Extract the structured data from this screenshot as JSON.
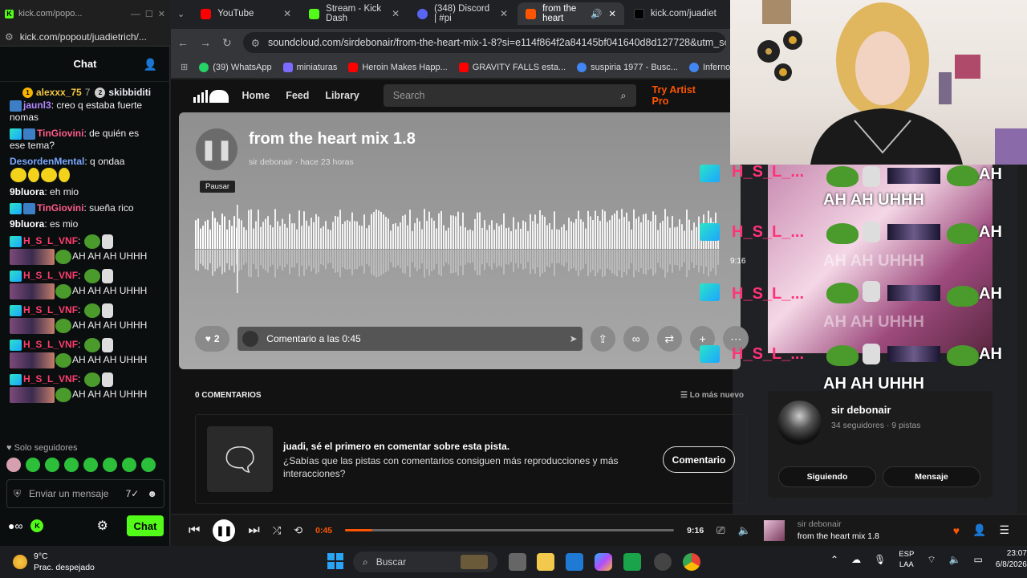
{
  "kick": {
    "window_title": "kick.com/popo...",
    "url": "kick.com/popout/juadietrich/...",
    "chat_title": "Chat",
    "gifters": [
      {
        "name": "alexxx_75",
        "count": "7"
      },
      {
        "name": "skibbiditi",
        "count": "2"
      }
    ],
    "messages": [
      {
        "user": "jaunl3",
        "color": "#b388ff",
        "text": "creo q estaba fuerte nomas"
      },
      {
        "user": "TinGiovini",
        "color": "#ff5c8a",
        "text": "de quién es ese tema?"
      },
      {
        "user": "DesordenMental",
        "color": "#7aa7ff",
        "text": "q ondaa"
      },
      {
        "user": "9bluora",
        "color": "#ffffff",
        "text": "eh mio"
      },
      {
        "user": "TinGiovini",
        "color": "#ff5c8a",
        "text": "sueña rico"
      },
      {
        "user": "9bluora",
        "color": "#ffffff",
        "text": "es mio"
      },
      {
        "user": "H_S_L_VNF",
        "color": "#ff3d6e",
        "text": "AH AH AH UHHH"
      },
      {
        "user": "H_S_L_VNF",
        "color": "#ff3d6e",
        "text": "AH AH AH UHHH"
      },
      {
        "user": "H_S_L_VNF",
        "color": "#ff3d6e",
        "text": "AH AH AH UHHH"
      },
      {
        "user": "H_S_L_VNF",
        "color": "#ff3d6e",
        "text": "AH AH AH UHHH"
      },
      {
        "user": "H_S_L_VNF",
        "color": "#ff3d6e",
        "text": "AH AH AH UHHH"
      }
    ],
    "followers_only": "Solo seguidores",
    "input_placeholder": "Enviar un mensaje",
    "chat_button": "Chat"
  },
  "browser": {
    "tabs": [
      {
        "title": "YouTube",
        "icon_color": "#ff0000",
        "active": false
      },
      {
        "title": "Stream - Kick Dash",
        "icon_color": "#53fc18",
        "active": false
      },
      {
        "title": "(348) Discord | #pi",
        "icon_color": "#5865f2",
        "active": false
      },
      {
        "title": "from the heart",
        "icon_color": "#ff5500",
        "active": true
      },
      {
        "title": "kick.com/juadiet",
        "icon_color": "#000000",
        "active": false
      }
    ],
    "url": "soundcloud.com/sirdebonair/from-the-heart-mix-1-8?si=e114f864f2a84145bf041640d8d127728&utm_source=",
    "bookmarks": [
      {
        "label": "(39) WhatsApp",
        "color": "#25d366"
      },
      {
        "label": "miniaturas",
        "color": "#7b6cff"
      },
      {
        "label": "Heroin Makes Happ...",
        "color": "#ff0000"
      },
      {
        "label": "GRAVITY FALLS esta...",
        "color": "#ff0000"
      },
      {
        "label": "suspiria 1977 - Busc...",
        "color": "#4285f4"
      },
      {
        "label": "Inferno 1980 - B",
        "color": "#4285f4"
      }
    ]
  },
  "soundcloud": {
    "nav": {
      "home": "Home",
      "feed": "Feed",
      "library": "Library",
      "search_placeholder": "Search",
      "try_artist": "Try Artist Pro"
    },
    "track": {
      "title": "from the heart mix 1.8",
      "artist": "sir debonair",
      "posted": "hace 23 horas",
      "pause_tooltip": "Pausar",
      "duration": "9:16",
      "likes": "2",
      "comment_placeholder": "Comentario a las 0:45"
    },
    "comments_header": "0 COMENTARIOS",
    "sort_label": "Lo más nuevo",
    "first_comment_title": "juadi, sé el primero en comentar sobre esta pista.",
    "first_comment_text": "¿Sabías que las pistas con comentarios consiguen más reproducciones y más interacciones?",
    "comment_button": "Comentario",
    "artist_card": {
      "name": "sir debonair",
      "stats": "34 seguidores · 9 pistas",
      "follow_label": "Siguiendo",
      "message_label": "Mensaje"
    },
    "player": {
      "current_time": "0:45",
      "duration": "9:16",
      "progress": 0.082,
      "artist": "sir debonair",
      "title": "from the heart mix 1.8"
    }
  },
  "overlay": {
    "username": "H_S_L_...",
    "chant": "AH AH UHHH",
    "ah": "AH"
  },
  "taskbar": {
    "temperature": "9°C",
    "weather": "Prac. despejado",
    "search": "Buscar",
    "lang_top": "ESP",
    "lang_bottom": "LAA",
    "time": "23:07",
    "date": "6/8/2026"
  }
}
